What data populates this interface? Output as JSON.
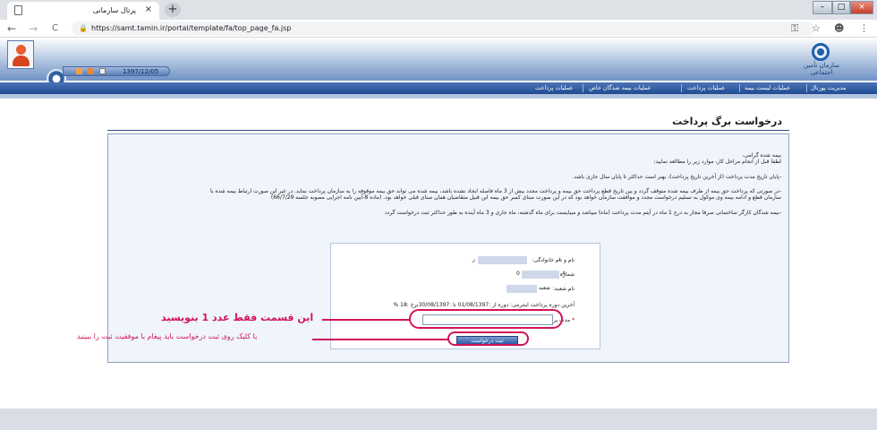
{
  "browser": {
    "tab_title": "پرتال سازمانی",
    "tab_close": "×",
    "new_tab": "+",
    "url": "https://samt.tamin.ir/portal/template/fa/top_page_fa.jsp",
    "nav_back": "←",
    "nav_forward": "→",
    "nav_reload": "C",
    "lock": "🔒",
    "key_icon": "⚿",
    "star_icon": "☆",
    "account_icon": "☻",
    "menu_icon": "⋮",
    "win_min": "–",
    "win_max": "□",
    "win_close": "×"
  },
  "header": {
    "date": "1397/12/05",
    "org_logo_text": "سازمان تأمین اجتماعی"
  },
  "menu": {
    "items": [
      "مدیریت پورتال",
      "عملیات لیست بیمه",
      "عملیات پرداخت",
      "عملیات بیمه شدگان خاص",
      "عملیات پرداخت"
    ]
  },
  "page": {
    "title": "درخواست برگ پرداخت",
    "paragraphs": [
      "بیمه شده گرامی،",
      "لطفا قبل از انجام مراحل کار، موارد زیر را مطالعه نمایید:",
      "-پایان تاریخ مدت پرداخت (از آخرین تاریخ پرداخت)، بهتر است حداکثر تا پایان سال جاری باشد.",
      "-در صورتی که پرداخت حق بیمه از طرف بیمه شده متوقف گردد و بین تاریخ قطع پرداخت حق بیمه و پرداخت مجدد بیش از 3 ماه فاصله ایجاد نشده باشد، بیمه شده می تواند حق بیمه موقوفه را به سازمان پرداخت نماید. در غیر این صورت ارتباط بیمه شده با",
      "سازمان قطع و ادامه بیمه وی موکول به تسلیم درخواست مجدد و موافقت سازمان خواهد بود که در این صورت مبنای کسر حق بیمه این قبیل متقاضیان همان مبنای قبلی خواهد بود. (ماده 8-آیین نامه اجرایی مصوبه جلسه 66/7/29)",
      "-بیمه شدگان کارگر ساختمانی صرفا مجاز به درج 1 ماه در آیتم مدت پرداخت (ماه) میباشد و میبایست برای ماه گذشته، ماه جاری و 3 ماه آینده به طور حداکثر ثبت درخواست گردد"
    ]
  },
  "form": {
    "name_label": "نام و نام خانوادگی:",
    "name_value_start": "د",
    "name_value_end": "ر",
    "insurance_label": "شماره بیمه:",
    "insurance_value_start": "4",
    "insurance_value_end": "0",
    "branch_label": "نام شعبه:",
    "branch_value": "شعبه",
    "period_text": "آخرین دوره پرداخت اینترنتی: دوره از :01/08/1397 تا :30/08/1397نرخ :18 %",
    "duration_label": "مدت پرداخت(ماه):",
    "required_mark": "*",
    "duration_value": "",
    "submit_label": "ثبت درخواست"
  },
  "annotations": {
    "input_note": "این قسمت فقط عدد 1 بنویسید",
    "submit_note": "با کلیک روی ثبت درخواست باید پیغام با موفقیت ثبت را ببینید",
    "color": "#d1145a"
  }
}
